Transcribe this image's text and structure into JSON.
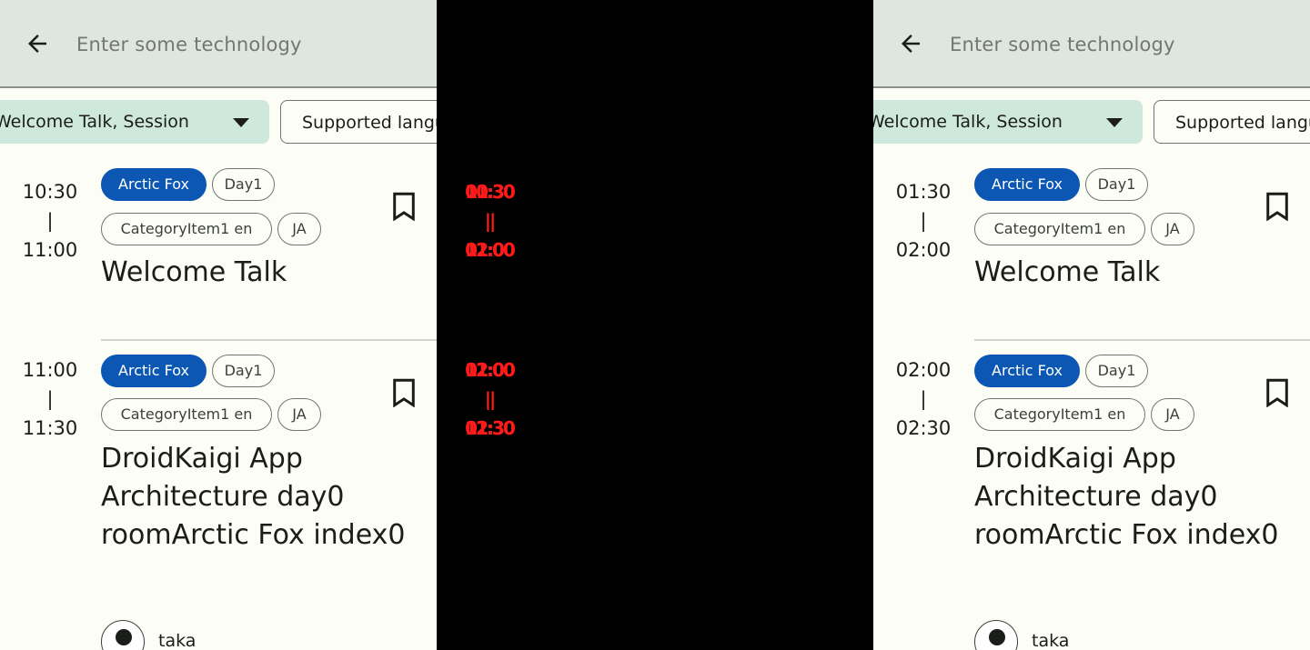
{
  "app": {
    "search_placeholder": "Enter some technology"
  },
  "filters": {
    "category_label": "Welcome Talk, Session",
    "language_label": "Supported languages"
  },
  "left": {
    "sessions": [
      {
        "start": "10:30",
        "sep": "|",
        "end": "11:00",
        "room": "Arctic Fox",
        "day": "Day1",
        "category": "CategoryItem1 en",
        "lang": "JA",
        "title": "Welcome Talk"
      },
      {
        "start": "11:00",
        "sep": "|",
        "end": "11:30",
        "room": "Arctic Fox",
        "day": "Day1",
        "category": "CategoryItem1 en",
        "lang": "JA",
        "title": "DroidKaigi App Architecture day0 roomArctic Fox index0",
        "speaker": "taka"
      }
    ]
  },
  "right": {
    "sessions": [
      {
        "start": "01:30",
        "sep": "|",
        "end": "02:00",
        "room": "Arctic Fox",
        "day": "Day1",
        "category": "CategoryItem1 en",
        "lang": "JA",
        "title": "Welcome Talk"
      },
      {
        "start": "02:00",
        "sep": "|",
        "end": "02:30",
        "room": "Arctic Fox",
        "day": "Day1",
        "category": "CategoryItem1 en",
        "lang": "JA",
        "title": "DroidKaigi App Architecture day0 roomArctic Fox index0",
        "speaker": "taka"
      }
    ]
  },
  "diff": {
    "block1": {
      "start": "10:30 01:30",
      "sep": "|",
      "end": "11:00 02:00"
    },
    "block2": {
      "start": "11:00 02:00",
      "sep": "|",
      "end": "11:30 02:30"
    }
  },
  "colors": {
    "topbar": "#dde6df",
    "background": "#fcfdf5",
    "room_tag": "#0b57b3",
    "category_chip": "#cfe8dd",
    "diff_text": "#ff1a1a"
  },
  "icons": {
    "back": "arrow-back-icon",
    "dropdown": "caret-down-icon",
    "bookmark": "bookmark-outline-icon",
    "avatar": "person-icon"
  }
}
